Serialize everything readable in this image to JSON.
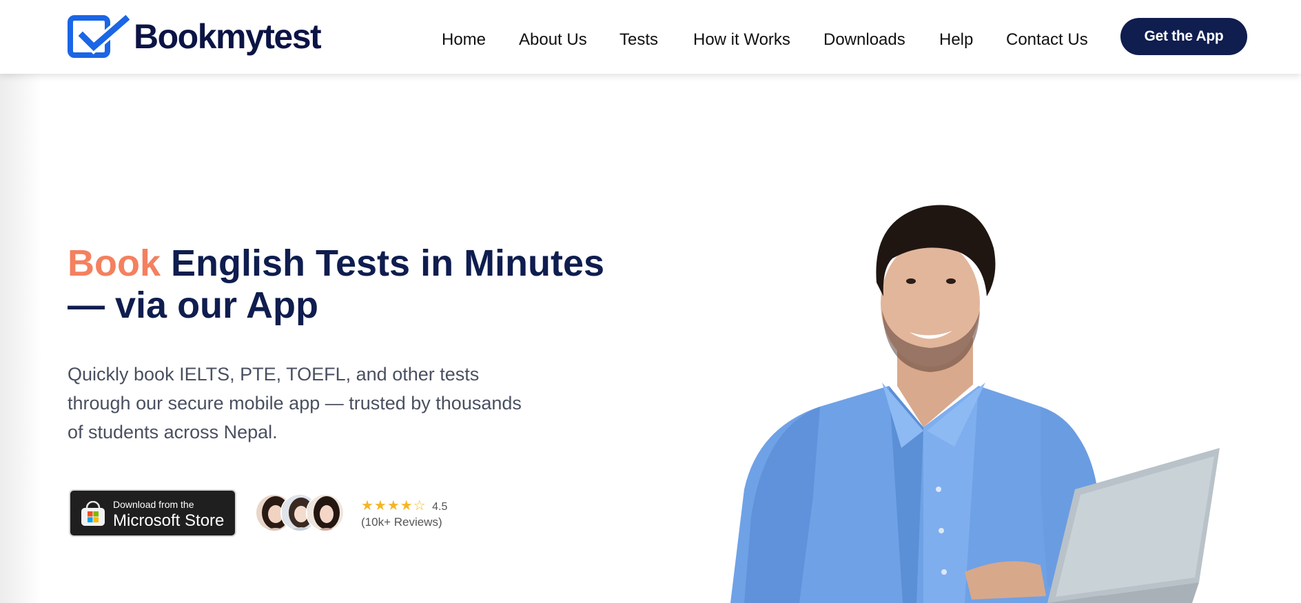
{
  "brand": {
    "name": "Bookmytest",
    "primary_color": "#0f1d4f",
    "accent_color": "#f4805e",
    "logo_icon_color": "#1a66e6"
  },
  "nav": {
    "items": [
      {
        "label": "Home"
      },
      {
        "label": "About Us"
      },
      {
        "label": "Tests"
      },
      {
        "label": "How it Works"
      },
      {
        "label": "Downloads"
      },
      {
        "label": "Help"
      },
      {
        "label": "Contact Us"
      }
    ],
    "cta_label": "Get the App"
  },
  "hero": {
    "title_accent": "Book",
    "title_rest": " English Tests in Minutes — via our App",
    "description": "Quickly book IELTS, PTE, TOEFL, and other tests through our secure mobile app — trusted by thousands of students across Nepal.",
    "store_badge": {
      "small_text": "Download from the",
      "big_text": "Microsoft Store",
      "icon": "microsoft-store-icon"
    },
    "rating": {
      "stars_filled": 4,
      "stars_total": 5,
      "stars_text": "★★★★☆",
      "value": "4.5",
      "reviews_text": "(10k+ Reviews)"
    },
    "avatars": [
      {
        "icon": "user-avatar"
      },
      {
        "icon": "user-avatar"
      },
      {
        "icon": "user-avatar"
      }
    ],
    "image": {
      "icon": "man-with-laptop-photo"
    }
  }
}
